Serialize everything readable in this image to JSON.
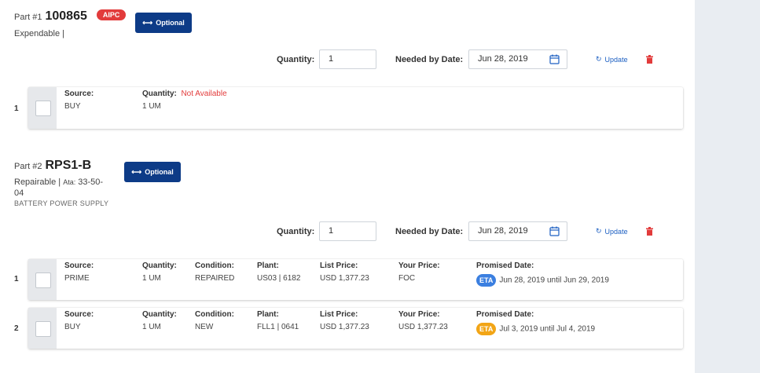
{
  "parts": [
    {
      "prefix": "Part #1",
      "number": "100865",
      "badge": "AIPC",
      "type_line": "Expendable |",
      "optional_label": "Optional",
      "quantity_label": "Quantity:",
      "quantity_value": "1",
      "needed_label": "Needed by Date:",
      "needed_value": "Jun 28, 2019",
      "update_label": "Update",
      "rows": [
        {
          "index": "1",
          "source_h": "Source:",
          "source": "BUY",
          "quantity_h": "Quantity:",
          "quantity": "1 UM",
          "availability": "Not Available"
        }
      ]
    },
    {
      "prefix": "Part #2",
      "number": "RPS1-B",
      "type_line": "Repairable |",
      "ata_label": "Ata:",
      "ata_value": "33-50-",
      "ata_value_2": "04",
      "description": "BATTERY POWER SUPPLY",
      "optional_label": "Optional",
      "quantity_label": "Quantity:",
      "quantity_value": "1",
      "needed_label": "Needed by Date:",
      "needed_value": "Jun 28, 2019",
      "update_label": "Update",
      "rows": [
        {
          "index": "1",
          "source_h": "Source:",
          "source": "PRIME",
          "quantity_h": "Quantity:",
          "quantity": "1 UM",
          "condition_h": "Condition:",
          "condition": "REPAIRED",
          "plant_h": "Plant:",
          "plant": "US03 | 6182",
          "list_h": "List Price:",
          "list": "USD 1,377.23",
          "your_h": "Your Price:",
          "your": "FOC",
          "promised_h": "Promised Date:",
          "eta": "ETA",
          "eta_color": "#3b7fe0",
          "promised": "Jun 28, 2019 until Jun 29, 2019"
        },
        {
          "index": "2",
          "source_h": "Source:",
          "source": "BUY",
          "quantity_h": "Quantity:",
          "quantity": "1 UM",
          "condition_h": "Condition:",
          "condition": "NEW",
          "plant_h": "Plant:",
          "plant": "FLL1 | 0641",
          "list_h": "List Price:",
          "list": "USD 1,377.23",
          "your_h": "Your Price:",
          "your": "USD 1,377.23",
          "promised_h": "Promised Date:",
          "eta": "ETA",
          "eta_color": "#f2a516",
          "promised": "Jul 3, 2019 until Jul 4, 2019"
        }
      ]
    }
  ],
  "colors": {
    "primary": "#0d3b87",
    "danger": "#e23b3b",
    "link": "#1c5fc2",
    "sidebar": "#e9edf2"
  }
}
